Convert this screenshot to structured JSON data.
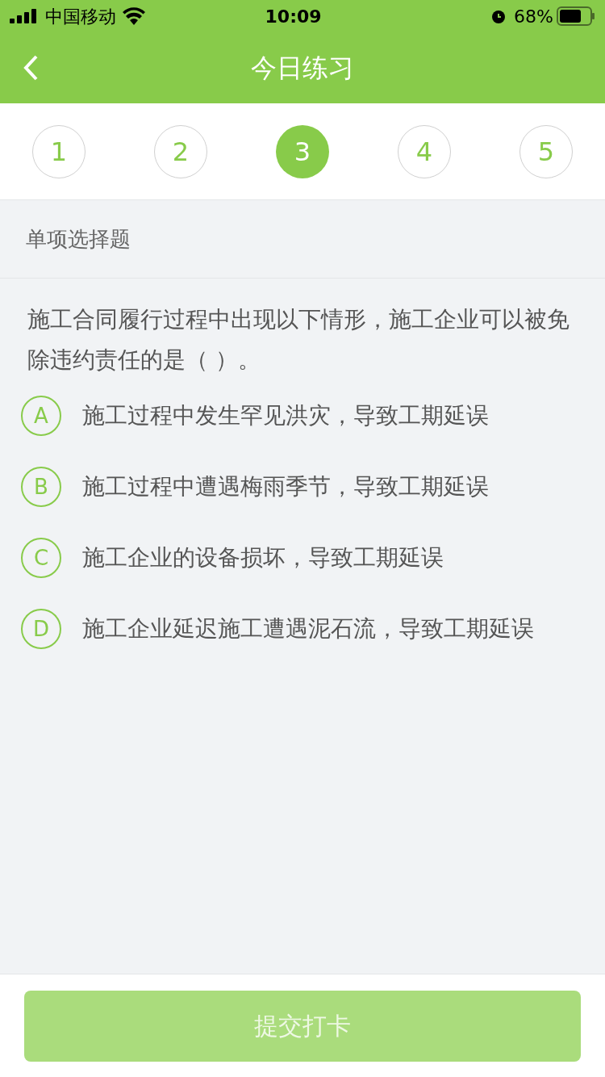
{
  "status_bar": {
    "carrier": "中国移动",
    "time": "10:09",
    "battery": "68%"
  },
  "nav": {
    "title": "今日练习"
  },
  "question_tabs": [
    {
      "label": "1",
      "selected": false
    },
    {
      "label": "2",
      "selected": false
    },
    {
      "label": "3",
      "selected": true
    },
    {
      "label": "4",
      "selected": false
    },
    {
      "label": "5",
      "selected": false
    }
  ],
  "section": "单项选择题",
  "question": "施工合同履行过程中出现以下情形，施工企业可以被免除违约责任的是（    ）。",
  "options": [
    {
      "letter": "A",
      "text": "施工过程中发生罕见洪灾，导致工期延误",
      "selected": false
    },
    {
      "letter": "B",
      "text": "施工过程中遭遇梅雨季节，导致工期延误",
      "selected": false
    },
    {
      "letter": "C",
      "text": "施工企业的设备损坏，导致工期延误",
      "selected": false
    },
    {
      "letter": "D",
      "text": "施工企业延迟施工遭遇泥石流，导致工期延误",
      "selected": false
    }
  ],
  "submit": {
    "label": "提交打卡",
    "disabled": true
  }
}
